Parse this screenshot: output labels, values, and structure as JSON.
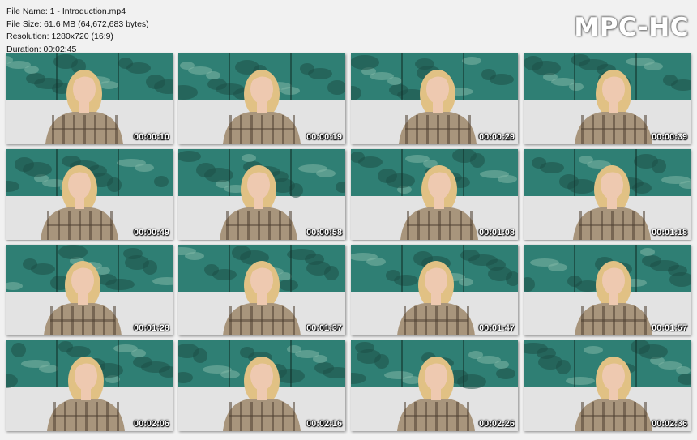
{
  "info": {
    "file_name": "File Name: 1 - Introduction.mp4",
    "file_size": "File Size: 61.6 MB (64,672,683 bytes)",
    "resolution": "Resolution: 1280x720 (16:9)",
    "duration": "Duration: 00:02:45"
  },
  "logo": "MPC-HC",
  "thumbnails": [
    {
      "time": "00:00:10"
    },
    {
      "time": "00:00:19"
    },
    {
      "time": "00:00:29"
    },
    {
      "time": "00:00:39"
    },
    {
      "time": "00:00:49"
    },
    {
      "time": "00:00:58"
    },
    {
      "time": "00:01:08"
    },
    {
      "time": "00:01:18"
    },
    {
      "time": "00:01:28"
    },
    {
      "time": "00:01:37"
    },
    {
      "time": "00:01:47"
    },
    {
      "time": "00:01:57"
    },
    {
      "time": "00:02:06"
    },
    {
      "time": "00:02:16"
    },
    {
      "time": "00:02:26"
    },
    {
      "time": "00:02:36"
    }
  ],
  "colors": {
    "wall": "#e3e3e3",
    "painting": "#2f7f74",
    "painting_dark": "#1d5147",
    "painting_light": "#7fb7a6",
    "hair": "#e1c184",
    "skin": "#eec9b0",
    "shirt": "#a8957c",
    "plaid": "#4e3f31"
  }
}
